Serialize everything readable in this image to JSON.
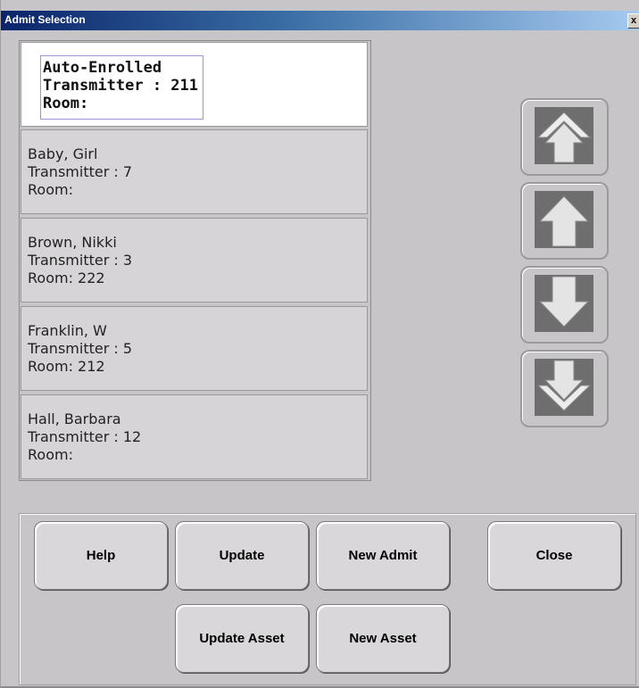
{
  "window": {
    "title": "Admit Selection",
    "close_glyph": "x"
  },
  "patients": [
    {
      "name": "Auto-Enrolled",
      "transmitter": "Transmitter : 211",
      "room": "Room:"
    },
    {
      "name": "Baby, Girl",
      "transmitter": "Transmitter : 7",
      "room": "Room:"
    },
    {
      "name": "Brown, Nikki",
      "transmitter": "Transmitter : 3",
      "room": "Room: 222"
    },
    {
      "name": "Franklin, W",
      "transmitter": "Transmitter : 5",
      "room": "Room: 212"
    },
    {
      "name": "Hall, Barbara",
      "transmitter": "Transmitter : 12",
      "room": "Room:"
    }
  ],
  "scroll_buttons": [
    "scroll-top-icon",
    "scroll-up-icon",
    "scroll-down-icon",
    "scroll-bottom-icon"
  ],
  "buttons": {
    "help": "Help",
    "update": "Update",
    "new_admit": "New Admit",
    "close": "Close",
    "update_asset": "Update Asset",
    "new_asset": "New Asset"
  },
  "colors": {
    "title_start": "#0a246a",
    "title_end": "#a6caf0",
    "selected_row": "#ffffff",
    "panel": "#c8c5c8"
  }
}
